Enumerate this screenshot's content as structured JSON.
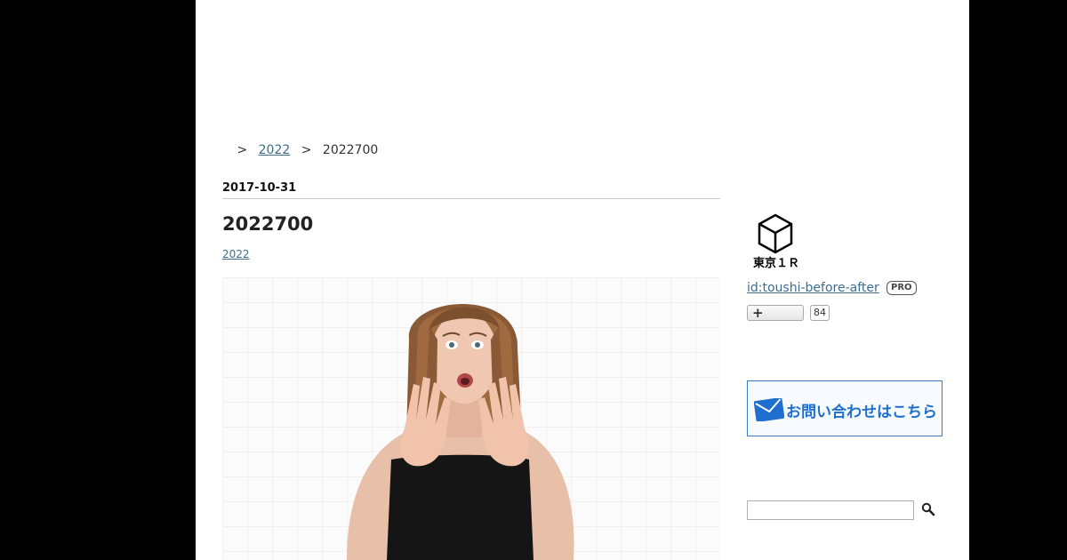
{
  "breadcrumb": {
    "home_label": "",
    "separator": ">",
    "items": [
      {
        "label": "2022"
      },
      {
        "label": "2022700"
      }
    ]
  },
  "entry": {
    "date": "2017-10-31",
    "title": "2022700",
    "category": "2022"
  },
  "sidebar": {
    "profile": {
      "icon_caption": "東京１Ｒ",
      "id_label": "id:toushi-before-after",
      "badge": "PRO"
    },
    "follow": {
      "plus_symbol": "+",
      "count": "84"
    },
    "contact_banner": {
      "label": "お問い合わせはこちら"
    },
    "search": {
      "placeholder": ""
    }
  },
  "colors": {
    "page_background": "#000000",
    "content_background": "#ffffff",
    "link": "#3d6c8e",
    "banner_accent": "#1e6fd0"
  }
}
